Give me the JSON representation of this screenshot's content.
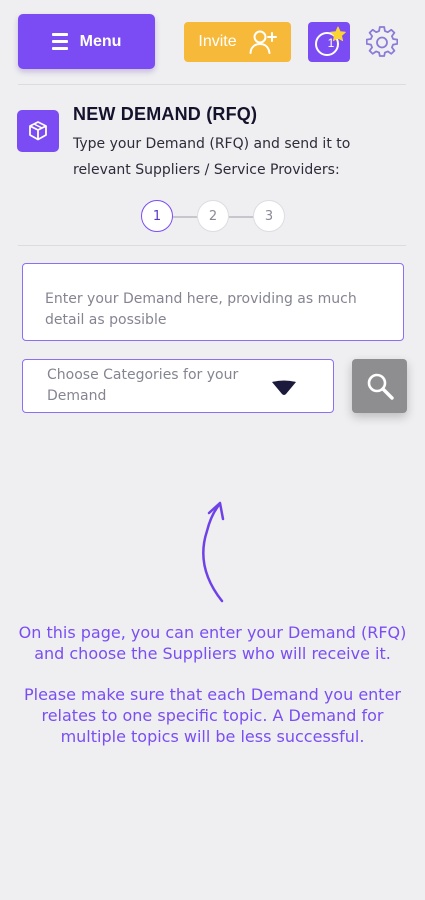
{
  "topbar": {
    "menu_label": "Menu",
    "invite_label": "Invite",
    "notification_count": "1",
    "colors": {
      "primary": "#7b4cf3",
      "invite": "#f7b93a"
    }
  },
  "header": {
    "title": "NEW DEMAND (RFQ)",
    "description": "Type your Demand (RFQ) and send it to relevant Suppliers / Service Providers:"
  },
  "stepper": {
    "steps": [
      "1",
      "2",
      "3"
    ],
    "active_step": 1
  },
  "form": {
    "demand_placeholder": "Enter your Demand here, providing as much detail as possible",
    "category_placeholder": "Choose Categories for your Demand"
  },
  "info": {
    "paragraph1": "On this page, you can enter your Demand (RFQ) and choose the Suppliers who will receive it.",
    "paragraph2": "Please make sure that each Demand you enter relates to one specific topic. A Demand for multiple topics will be less successful."
  }
}
